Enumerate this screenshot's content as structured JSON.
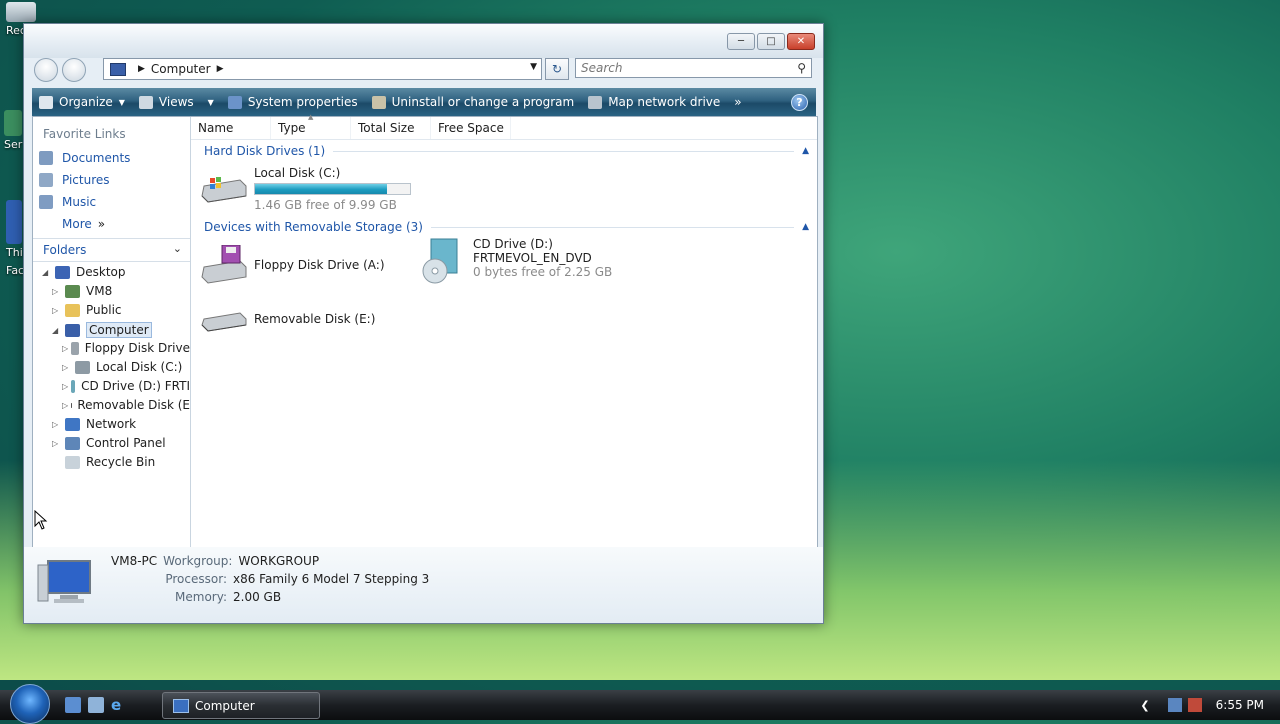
{
  "desktop": {
    "icons": [
      {
        "label": "Rec",
        "name": "recycle-bin-desktop-icon"
      },
      {
        "label": "Ser",
        "name": "desktop-icon-ser"
      },
      {
        "label": "Thi",
        "name": "desktop-icon-thi"
      },
      {
        "label": "Fac",
        "name": "desktop-icon-fac"
      }
    ]
  },
  "window": {
    "address": {
      "location": "Computer"
    },
    "search": {
      "placeholder": "Search"
    },
    "toolbar": {
      "organize": "Organize",
      "views": "Views",
      "system_properties": "System properties",
      "uninstall": "Uninstall or change a program",
      "map_drive": "Map network drive",
      "help": "?"
    },
    "nav": {
      "favorites_title": "Favorite Links",
      "favorites": [
        "Documents",
        "Pictures",
        "Music",
        "More"
      ],
      "folders_title": "Folders",
      "tree": {
        "desktop": "Desktop",
        "vm8": "VM8",
        "public": "Public",
        "computer": "Computer",
        "floppy": "Floppy Disk Drive",
        "local": "Local Disk (C:)",
        "cd": "CD Drive (D:) FRTI",
        "removable": "Removable Disk (E",
        "network": "Network",
        "control_panel": "Control Panel",
        "recycle_bin": "Recycle Bin"
      }
    },
    "columns": [
      "Name",
      "Type",
      "Total Size",
      "Free Space"
    ],
    "groups": {
      "hdd": "Hard Disk Drives (1)",
      "removable": "Devices with Removable Storage (3)"
    },
    "drives": {
      "c": {
        "name": "Local Disk (C:)",
        "free": "1.46 GB free of 9.99 GB",
        "used_fraction": 0.854
      },
      "a": {
        "name": "Floppy Disk Drive (A:)"
      },
      "d": {
        "name": "CD Drive (D:)",
        "label": "FRTMEVOL_EN_DVD",
        "free": "0 bytes free of 2.25 GB"
      },
      "e": {
        "name": "Removable Disk (E:)"
      }
    },
    "details": {
      "computer_name": "VM8-PC",
      "workgroup_label": "Workgroup:",
      "workgroup": "WORKGROUP",
      "processor_label": "Processor:",
      "processor": "x86 Family 6 Model 7 Stepping 3",
      "memory_label": "Memory:",
      "memory": "2.00 GB"
    }
  },
  "taskbar": {
    "task_label": "Computer",
    "clock": "6:55 PM"
  },
  "colors": {
    "toolbar": "#2f6180",
    "link_blue": "#1f56a8",
    "progress": "#1d9cc0",
    "desktop_green": "#1f7f63"
  }
}
